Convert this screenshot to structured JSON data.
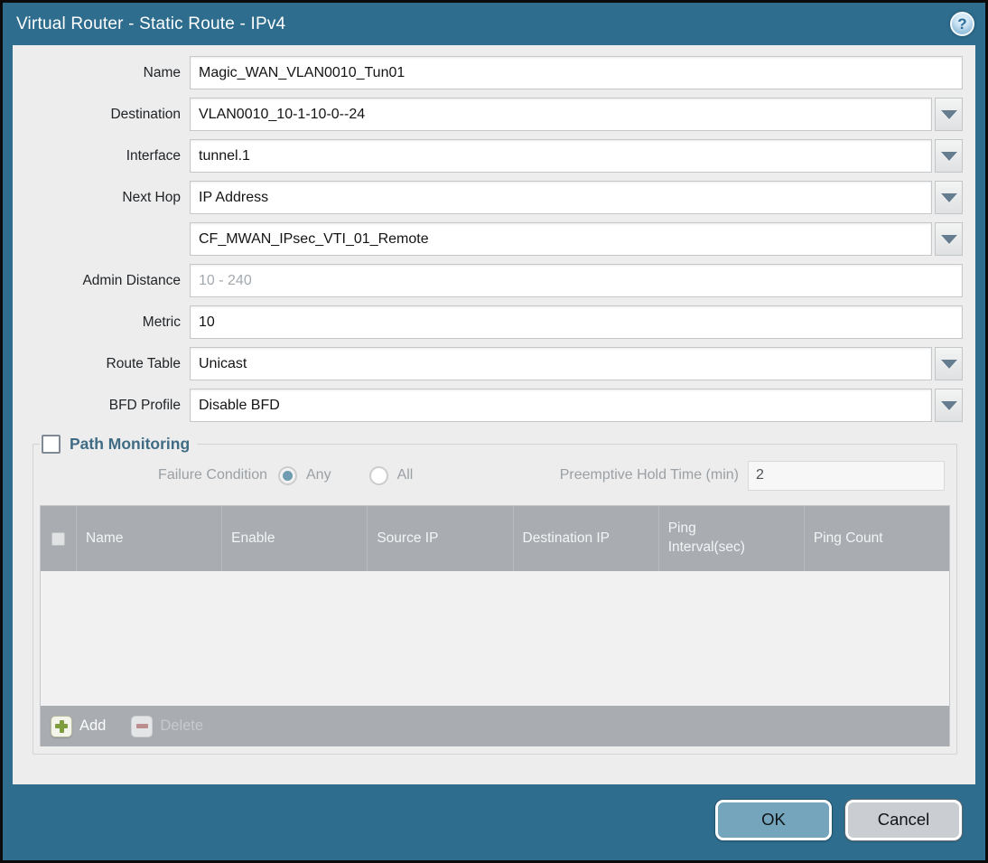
{
  "window": {
    "title": "Virtual Router - Static Route - IPv4",
    "help_icon": "?"
  },
  "form": {
    "name": {
      "label": "Name",
      "value": "Magic_WAN_VLAN0010_Tun01"
    },
    "destination": {
      "label": "Destination",
      "value": "VLAN0010_10-1-10-0--24"
    },
    "interface": {
      "label": "Interface",
      "value": "tunnel.1"
    },
    "next_hop": {
      "label": "Next Hop",
      "value": "IP Address"
    },
    "next_hop_address": {
      "value": "CF_MWAN_IPsec_VTI_01_Remote"
    },
    "admin_distance": {
      "label": "Admin Distance",
      "value": "",
      "placeholder": "10 - 240"
    },
    "metric": {
      "label": "Metric",
      "value": "10"
    },
    "route_table": {
      "label": "Route Table",
      "value": "Unicast"
    },
    "bfd_profile": {
      "label": "BFD Profile",
      "value": "Disable BFD"
    }
  },
  "path_monitoring": {
    "heading": "Path Monitoring",
    "enabled": false,
    "failure_condition": {
      "label": "Failure Condition",
      "options": [
        "Any",
        "All"
      ],
      "selected": "Any"
    },
    "preemptive_hold": {
      "label": "Preemptive Hold Time (min)",
      "value": "2"
    },
    "table": {
      "columns": [
        "Name",
        "Enable",
        "Source IP",
        "Destination IP",
        "Ping Interval(sec)",
        "Ping Count"
      ],
      "rows": [],
      "add_label": "Add",
      "delete_label": "Delete"
    }
  },
  "footer": {
    "ok": "OK",
    "cancel": "Cancel"
  },
  "colors": {
    "frame_teal": "#2e6d8e",
    "table_header_gray": "#a9adb1",
    "ok_button": "#74a5bc",
    "cancel_button": "#caced2",
    "add_icon_green": "#7f9c3f",
    "delete_icon_red": "#bb8d8d",
    "heading_teal": "#3f6b84"
  }
}
